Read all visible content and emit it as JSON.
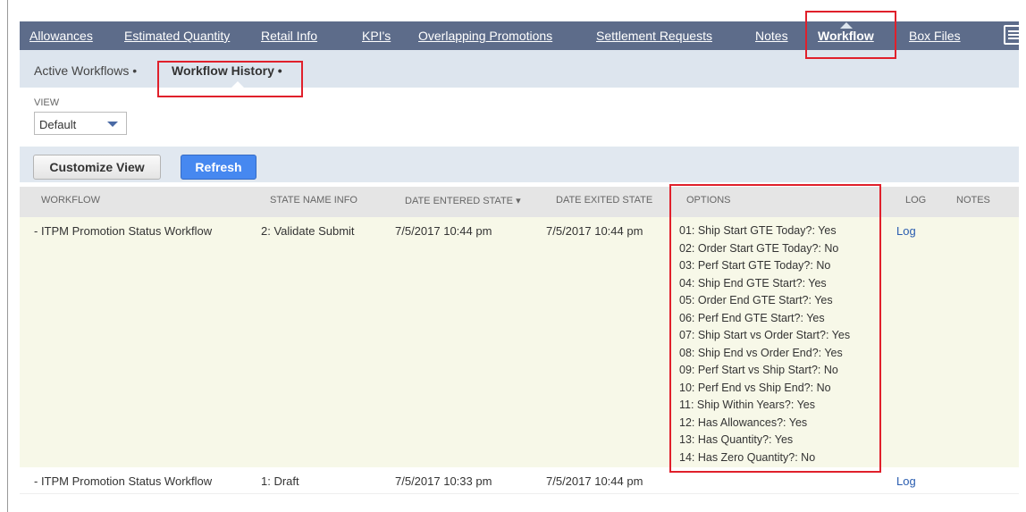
{
  "tabs": [
    {
      "label": "Allowances"
    },
    {
      "label": "Estimated Quantity"
    },
    {
      "label": "Retail Info"
    },
    {
      "label": "KPI's"
    },
    {
      "label": "Overlapping Promotions"
    },
    {
      "label": "Settlement Requests"
    },
    {
      "label": "Notes"
    },
    {
      "label": "Workflow"
    },
    {
      "label": "Box Files"
    }
  ],
  "active_tab": "Workflow",
  "subtabs": [
    {
      "label": "Active Workflows •"
    },
    {
      "label": "Workflow History •"
    }
  ],
  "view": {
    "label": "VIEW",
    "value": "Default"
  },
  "toolbar": {
    "customize_label": "Customize View",
    "refresh_label": "Refresh"
  },
  "table": {
    "headers": {
      "workflow": "WORKFLOW",
      "state": "STATE NAME INFO",
      "entered": "DATE ENTERED STATE ▾",
      "exited": "DATE EXITED STATE",
      "options": "OPTIONS",
      "log": "LOG",
      "notes": "NOTES"
    },
    "rows": [
      {
        "workflow": "- ITPM Promotion Status Workflow",
        "state": "2: Validate Submit",
        "entered": "7/5/2017 10:44 pm",
        "exited": "7/5/2017 10:44 pm",
        "options": [
          "01: Ship Start GTE Today?: Yes",
          "02: Order Start GTE Today?: No",
          "03: Perf Start GTE Today?: No",
          "04: Ship End GTE Start?: Yes",
          "05: Order End GTE Start?: Yes",
          "06: Perf End GTE Start?: Yes",
          "07: Ship Start vs Order Start?: Yes",
          "08: Ship End vs Order End?: Yes",
          "09: Perf Start vs Ship Start?: No",
          "10: Perf End vs Ship End?: No",
          "11: Ship Within Years?: Yes",
          "12: Has Allowances?: Yes",
          "13: Has Quantity?: Yes",
          "14: Has Zero Quantity?: No"
        ],
        "log": "Log"
      },
      {
        "workflow": "- ITPM Promotion Status Workflow",
        "state": "1: Draft",
        "entered": "7/5/2017 10:33 pm",
        "exited": "7/5/2017 10:44 pm",
        "options": [],
        "log": "Log"
      }
    ]
  },
  "colors": {
    "tabbar": "#5d6c8a",
    "subbar": "#dde5ee",
    "highlight": "#e0202b",
    "row_highlight": "#f7f8e8",
    "refresh": "#4688f0"
  }
}
